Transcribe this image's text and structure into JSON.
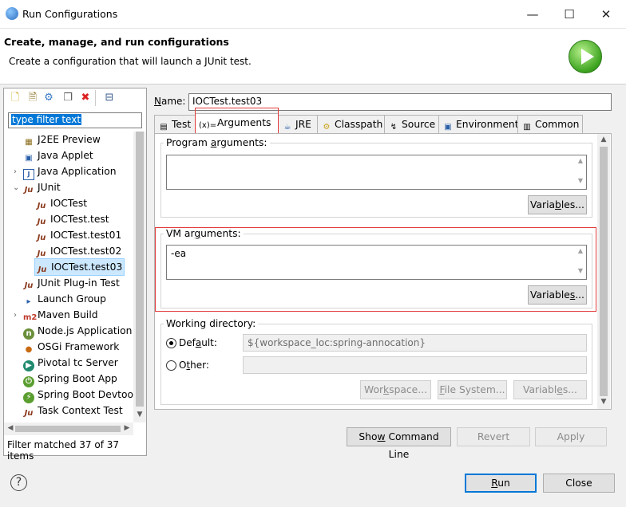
{
  "window": {
    "title": "Run Configurations",
    "minimize": "—",
    "maximize": "☐",
    "close": "✕"
  },
  "banner": {
    "title": "Create, manage, and run configurations",
    "message": "Create a configuration that will launch a JUnit test."
  },
  "sidebar": {
    "filter_value": "type filter text",
    "status": "Filter matched 37 of 37 items",
    "items": [
      {
        "label": "J2EE Preview",
        "icon": "server-icon"
      },
      {
        "label": "Java Applet",
        "icon": "applet-icon"
      },
      {
        "label": "Java Application",
        "icon": "java-app-icon"
      },
      {
        "label": "JUnit",
        "icon": "junit-icon"
      },
      {
        "label": "IOCTest",
        "icon": "junit-icon"
      },
      {
        "label": "IOCTest.test",
        "icon": "junit-icon"
      },
      {
        "label": "IOCTest.test01",
        "icon": "junit-icon"
      },
      {
        "label": "IOCTest.test02",
        "icon": "junit-icon"
      },
      {
        "label": "IOCTest.test03",
        "icon": "junit-icon"
      },
      {
        "label": "JUnit Plug-in Test",
        "icon": "junit-plugin-icon"
      },
      {
        "label": "Launch Group",
        "icon": "launch-group-icon"
      },
      {
        "label": "Maven Build",
        "icon": "maven-icon"
      },
      {
        "label": "Node.js Application",
        "icon": "nodejs-icon"
      },
      {
        "label": "OSGi Framework",
        "icon": "osgi-icon"
      },
      {
        "label": "Pivotal tc Server",
        "icon": "pivotal-icon"
      },
      {
        "label": "Spring Boot App",
        "icon": "spring-boot-icon"
      },
      {
        "label": "Spring Boot Devtools",
        "icon": "spring-devtools-icon"
      },
      {
        "label": "Task Context Test",
        "icon": "task-context-icon"
      }
    ],
    "selected": "IOCTest.test03"
  },
  "config": {
    "name_label": "Name:",
    "name_value": "IOCTest.test03",
    "tabs": [
      {
        "label": "Test",
        "icon": "test-tab-icon"
      },
      {
        "label": "Arguments",
        "icon": "arguments-tab-icon"
      },
      {
        "label": "JRE",
        "icon": "jre-tab-icon"
      },
      {
        "label": "Classpath",
        "icon": "classpath-tab-icon"
      },
      {
        "label": "Source",
        "icon": "source-tab-icon"
      },
      {
        "label": "Environment",
        "icon": "environment-tab-icon"
      },
      {
        "label": "Common",
        "icon": "common-tab-icon"
      }
    ],
    "active_tab": "Arguments",
    "program_args_label": "Program arguments:",
    "program_args_value": "",
    "vm_args_label": "VM arguments:",
    "vm_args_value": "-ea",
    "variables_label": "Variables...",
    "working_dir_label": "Working directory:",
    "default_label": "Default:",
    "default_value": "${workspace_loc:spring-annocation}",
    "other_label": "Other:",
    "other_value": "",
    "workspace_label": "Workspace...",
    "filesystem_label": "File System...",
    "show_cmd_label": "Show Command Line",
    "revert_label": "Revert",
    "apply_label": "Apply"
  },
  "footer": {
    "run_label": "Run",
    "close_label": "Close"
  },
  "colors": {
    "highlight": "#e23b3b",
    "selection": "#cce8ff",
    "accent": "#0078d7"
  }
}
